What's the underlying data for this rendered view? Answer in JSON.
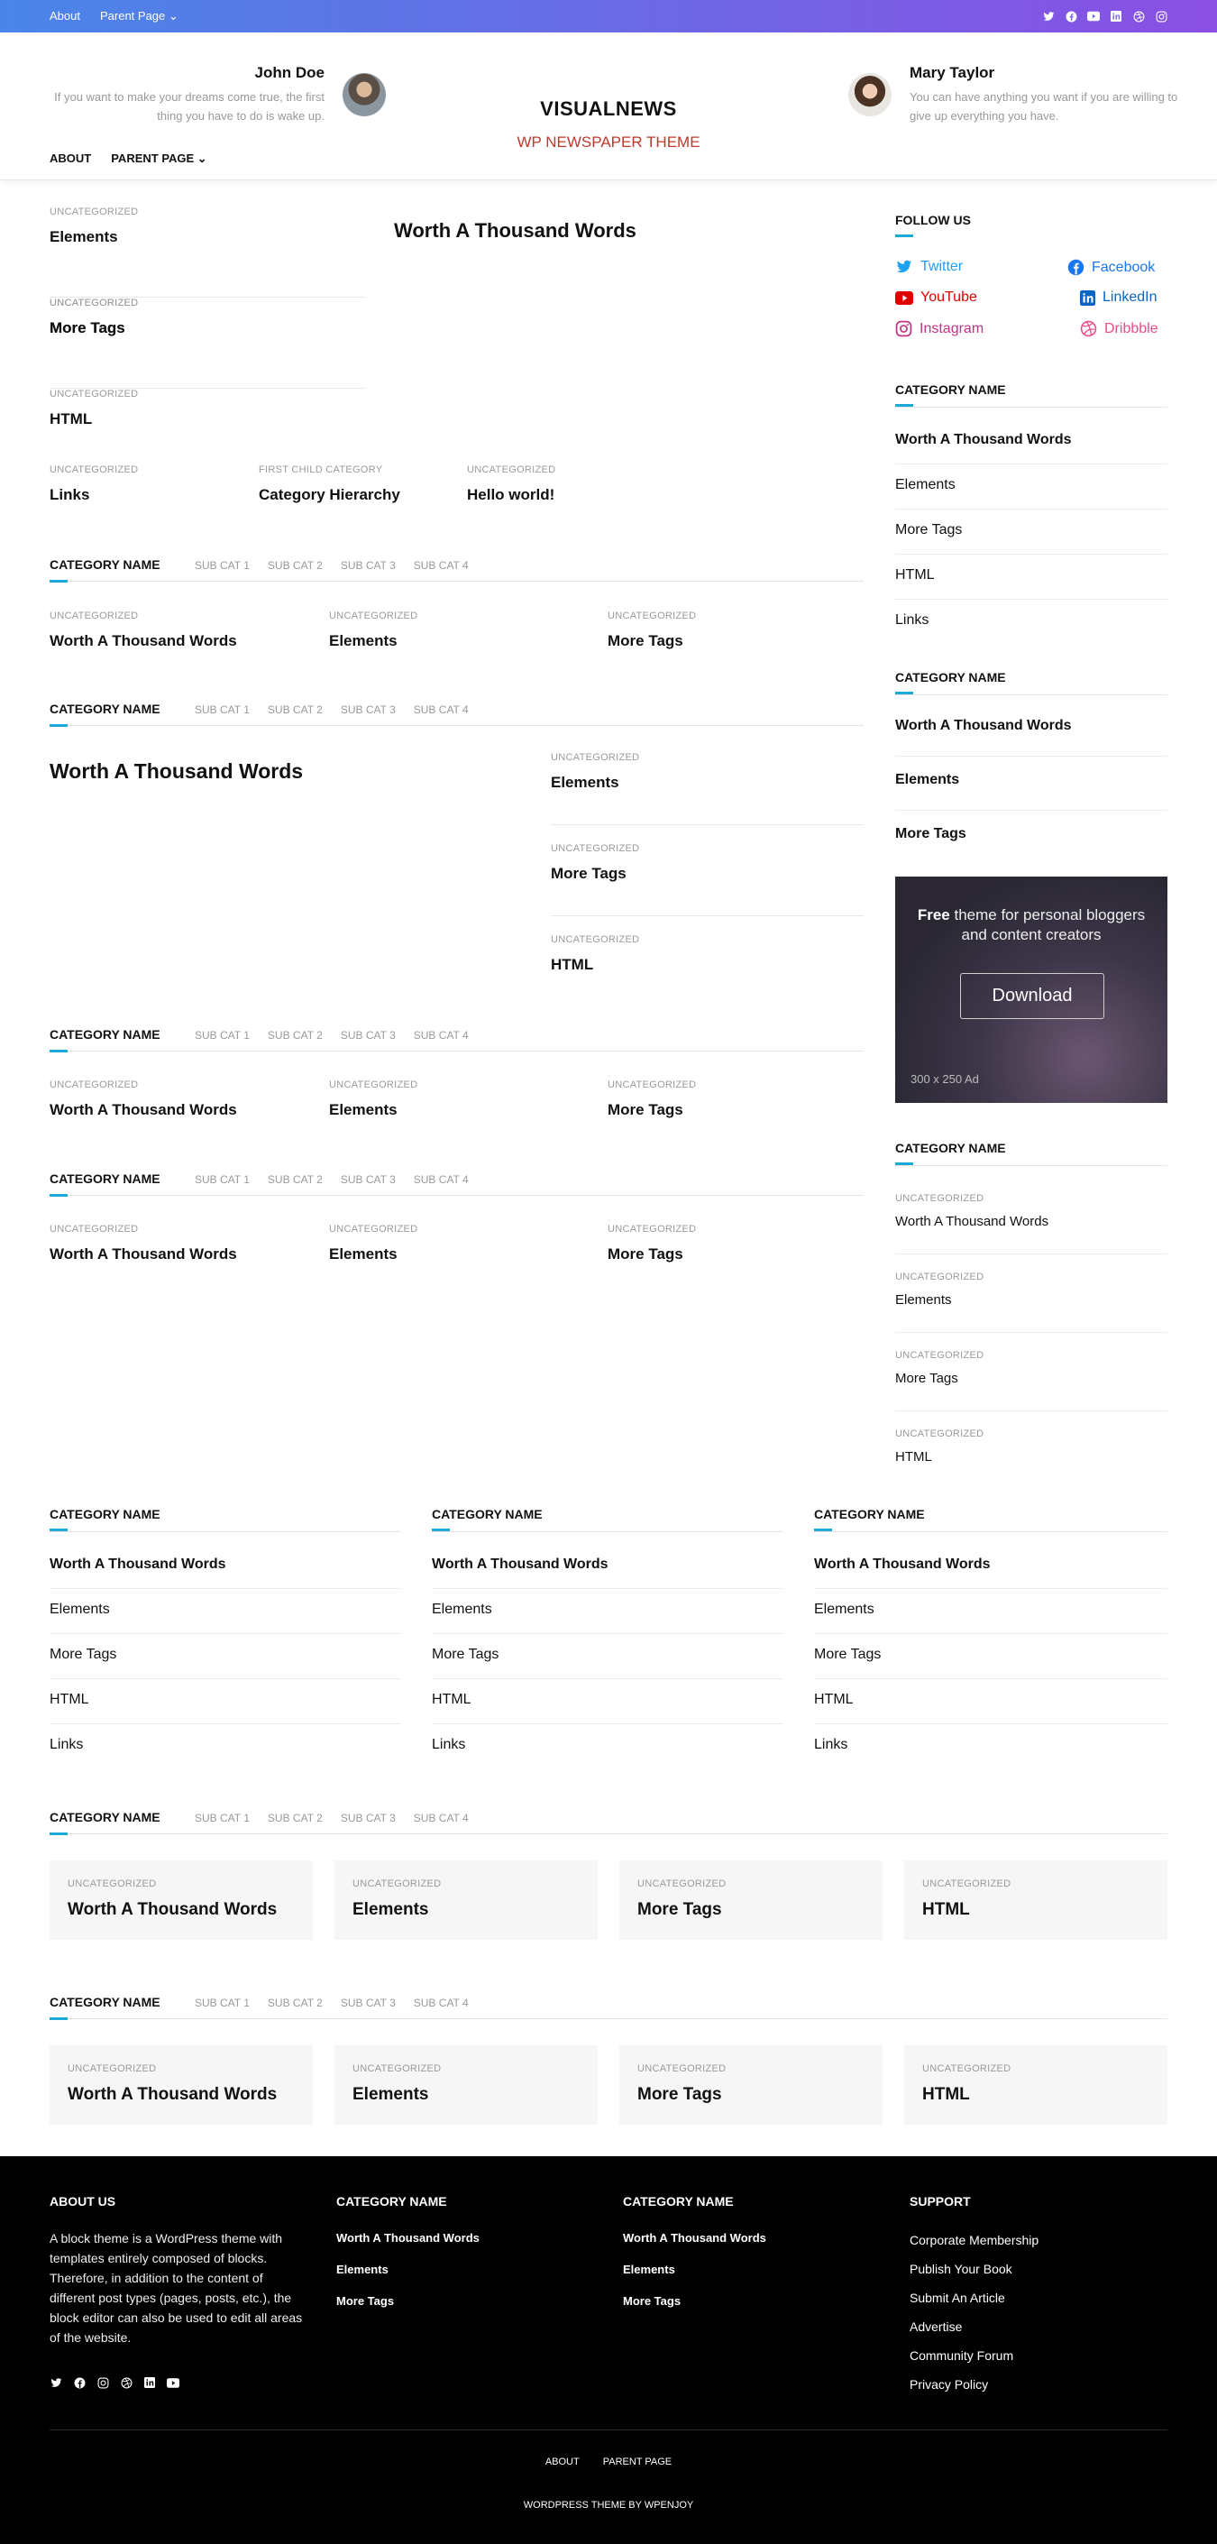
{
  "topbar": {
    "links": [
      "About",
      "Parent Page ⌄"
    ],
    "social_icons": [
      "twitter-icon",
      "facebook-icon",
      "youtube-icon",
      "linkedin-icon",
      "dribbble-icon",
      "instagram-icon"
    ]
  },
  "header": {
    "left_author": {
      "name": "John Doe",
      "bio": "If you want to make your dreams come true, the first thing you have to do is wake up."
    },
    "site_title": "VISUALNEWS",
    "site_tagline": "WP NEWSPAPER THEME",
    "right_author": {
      "name": "Mary Taylor",
      "bio": "You can have anything you want if you are willing to give up everything you have."
    },
    "nav": [
      "ABOUT",
      "PARENT PAGE ⌄"
    ]
  },
  "featured": {
    "left_list": [
      {
        "cat": "UNCATEGORIZED",
        "title": "Elements"
      },
      {
        "cat": "UNCATEGORIZED",
        "title": "More Tags"
      },
      {
        "cat": "UNCATEGORIZED",
        "title": "HTML"
      }
    ],
    "main_title": "Worth A Thousand Words",
    "bottom_row": [
      {
        "cat": "UNCATEGORIZED",
        "title": "Links"
      },
      {
        "cat": "FIRST CHILD CATEGORY",
        "title": "Category Hierarchy"
      },
      {
        "cat": "UNCATEGORIZED",
        "title": "Hello world!"
      }
    ]
  },
  "section_name": "CATEGORY NAME",
  "sub_cats": [
    "SUB CAT 1",
    "SUB CAT 2",
    "SUB CAT 3",
    "SUB CAT 4"
  ],
  "grid3": [
    {
      "cat": "UNCATEGORIZED",
      "title": "Worth A Thousand Words"
    },
    {
      "cat": "UNCATEGORIZED",
      "title": "Elements"
    },
    {
      "cat": "UNCATEGORIZED",
      "title": "More Tags"
    }
  ],
  "section2": {
    "big_title": "Worth A Thousand Words",
    "list": [
      {
        "cat": "UNCATEGORIZED",
        "title": "Elements"
      },
      {
        "cat": "UNCATEGORIZED",
        "title": "More Tags"
      },
      {
        "cat": "UNCATEGORIZED",
        "title": "HTML"
      }
    ]
  },
  "list5": [
    "Worth A Thousand Words",
    "Elements",
    "More Tags",
    "HTML",
    "Links"
  ],
  "cards": [
    {
      "cat": "UNCATEGORIZED",
      "title": "Worth A Thousand Words"
    },
    {
      "cat": "UNCATEGORIZED",
      "title": "Elements"
    },
    {
      "cat": "UNCATEGORIZED",
      "title": "More Tags"
    },
    {
      "cat": "UNCATEGORIZED",
      "title": "HTML"
    }
  ],
  "sidebar": {
    "follow_title": "FOLLOW US",
    "social": [
      {
        "label": "Twitter",
        "icon": "twitter-icon",
        "color": "#1da1f2"
      },
      {
        "label": "Facebook",
        "icon": "facebook-icon",
        "color": "#1877f2"
      },
      {
        "label": "YouTube",
        "icon": "youtube-icon",
        "color": "#e00000"
      },
      {
        "label": "LinkedIn",
        "icon": "linkedin-icon",
        "color": "#0a66c2"
      },
      {
        "label": "Instagram",
        "icon": "instagram-icon",
        "color": "#c13584"
      },
      {
        "label": "Dribbble",
        "icon": "dribbble-icon",
        "color": "#ea4c89"
      }
    ],
    "list2": [
      "Worth A Thousand Words",
      "Elements",
      "More Tags"
    ],
    "ad": {
      "free": "Free",
      "text1": " theme for personal bloggers",
      "text2": "and content creators",
      "button": "Download",
      "size": "300 x 250 Ad"
    },
    "list3": [
      {
        "cat": "UNCATEGORIZED",
        "title": "Worth A Thousand Words"
      },
      {
        "cat": "UNCATEGORIZED",
        "title": "Elements"
      },
      {
        "cat": "UNCATEGORIZED",
        "title": "More Tags"
      },
      {
        "cat": "UNCATEGORIZED",
        "title": "HTML"
      }
    ]
  },
  "footer": {
    "about_title": "ABOUT US",
    "about_text": "A block theme is a WordPress theme with templates entirely composed of blocks. Therefore, in addition to the content of different post types (pages, posts, etc.), the block editor can also be used to edit all areas of the website.",
    "cat_links": [
      "Worth A Thousand Words",
      "Elements",
      "More Tags"
    ],
    "support_title": "SUPPORT",
    "support_links": [
      "Corporate Membership",
      "Publish Your Book",
      "Submit An Article",
      "Advertise",
      "Community Forum",
      "Privacy Policy"
    ],
    "bottom_nav": [
      "ABOUT",
      "PARENT PAGE"
    ],
    "credit": "WORDPRESS THEME BY WPENJOY"
  },
  "accent_color": "#1ba9d6"
}
